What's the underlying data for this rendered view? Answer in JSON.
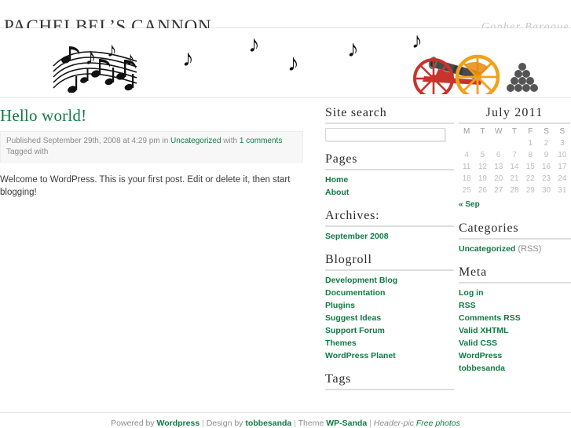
{
  "header": {
    "blog_title": "PACHELBEL’S CANNON",
    "blog_description": "Gopher Baroque"
  },
  "header_pic": {
    "alt": "musical staff with notes and a cannon with cannonballs"
  },
  "post": {
    "title": "Hello world!",
    "meta_published_prefix": "Published September 29th, 2008 at 4:29 pm in ",
    "meta_category": "Uncategorized",
    "meta_with": " with ",
    "meta_comments": "1 comments",
    "meta_tagged": "Tagged with",
    "body": "Welcome to WordPress. This is your first post. Edit or delete it, then start blogging!"
  },
  "sidebar_one": {
    "search": {
      "title": "Site search",
      "value": "",
      "placeholder": ""
    },
    "pages": {
      "title": "Pages",
      "items": [
        "Home",
        "About"
      ]
    },
    "archives": {
      "title": "Archives:",
      "items": [
        "September 2008"
      ]
    },
    "blogroll": {
      "title": "Blogroll",
      "items": [
        "Development Blog",
        "Documentation",
        "Plugins",
        "Suggest Ideas",
        "Support Forum",
        "Themes",
        "WordPress Planet"
      ]
    },
    "tags": {
      "title": "Tags",
      "items": []
    }
  },
  "sidebar_two": {
    "calendar": {
      "caption": "July 2011",
      "weekdays": [
        "M",
        "T",
        "W",
        "T",
        "F",
        "S",
        "S"
      ],
      "weeks": [
        [
          "",
          "",
          "",
          "",
          "1",
          "2",
          "3"
        ],
        [
          "4",
          "5",
          "6",
          "7",
          "8",
          "9",
          "10"
        ],
        [
          "11",
          "12",
          "13",
          "14",
          "15",
          "16",
          "17"
        ],
        [
          "18",
          "19",
          "20",
          "21",
          "22",
          "23",
          "24"
        ],
        [
          "25",
          "26",
          "27",
          "28",
          "29",
          "30",
          "31"
        ]
      ],
      "prev_link": "« Sep"
    },
    "categories": {
      "title": "Categories",
      "item_label": "Uncategorized",
      "item_rss": " (RSS)"
    },
    "meta": {
      "title": "Meta",
      "items": [
        "Log in",
        "RSS",
        "Comments RSS",
        "Valid XHTML",
        "Valid CSS",
        "WordPress",
        "tobbesanda"
      ]
    }
  },
  "footer": {
    "powered_by": "Powered by ",
    "wordpress": "Wordpress",
    "sep1": " | ",
    "design_by": "Design by ",
    "designer": "tobbesanda",
    "sep2": " | ",
    "theme_label": "Theme ",
    "theme_name": "WP-Sanda",
    "sep3": " | ",
    "header_pic_label": "Header-pic ",
    "header_pic_link": "Free photos"
  },
  "colors": {
    "link_green": "#0f7a43",
    "title_green": "#127b44",
    "muted_gray": "#8f8f8f",
    "cannon_red": "#c8342c",
    "cannon_orange": "#f0a21b"
  }
}
